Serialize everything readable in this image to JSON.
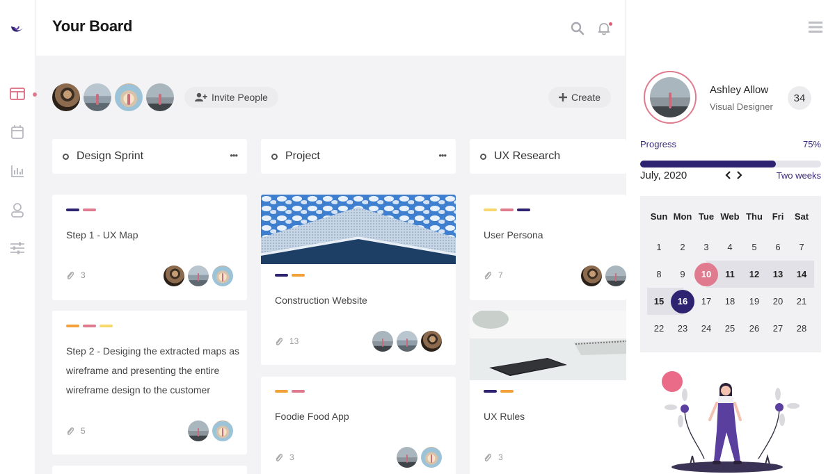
{
  "header": {
    "title": "Your Board"
  },
  "team": {
    "invite_label": "Invite People",
    "create_label": "Create"
  },
  "colors": {
    "pink": "#e07a8f",
    "navy": "#2e2370",
    "orange": "#f3a23a",
    "yellow": "#f6d86b",
    "purple": "#5a3f9e"
  },
  "columns": [
    {
      "title": "Design Sprint",
      "cards": [
        {
          "title": "Step 1 - UX Map",
          "attachments": "3",
          "tags": [
            "navy",
            "pink"
          ]
        },
        {
          "title_lines": [
            "Step 2 - Desiging the extracted maps as",
            "wireframe and presenting the entire",
            "wireframe design to the customer"
          ],
          "attachments": "5",
          "tags": [
            "orange",
            "pink",
            "yellow"
          ]
        }
      ]
    },
    {
      "title": "Project",
      "cards": [
        {
          "title": "Construction Website",
          "attachments": "13",
          "tags": [
            "navy",
            "orange"
          ]
        },
        {
          "title": "Foodie Food App",
          "attachments": "3",
          "tags": [
            "orange",
            "pink"
          ]
        }
      ]
    },
    {
      "title": "UX Research",
      "cards": [
        {
          "title": "User Persona",
          "attachments": "7",
          "tags": [
            "yellow",
            "pink",
            "navy"
          ]
        },
        {
          "title": "UX Rules",
          "attachments": "3",
          "tags": [
            "navy",
            "orange"
          ]
        }
      ]
    }
  ],
  "profile": {
    "name": "Ashley Allow",
    "role": "Visual Designer",
    "count": "34",
    "progress_label": "Progress",
    "progress_value": "75%",
    "progress_fraction": 0.75
  },
  "calendar": {
    "month": "July, 2020",
    "range": "Two weeks",
    "day_names": [
      "Sun",
      "Mon",
      "Tue",
      "Web",
      "Thu",
      "Fri",
      "Sat"
    ],
    "weeks": [
      [
        "1",
        "2",
        "3",
        "4",
        "5",
        "6",
        "7"
      ],
      [
        "8",
        "9",
        "10",
        "11",
        "12",
        "13",
        "14"
      ],
      [
        "15",
        "16",
        "17",
        "18",
        "19",
        "20",
        "21"
      ],
      [
        "22",
        "23",
        "24",
        "25",
        "26",
        "27",
        "28"
      ]
    ],
    "marked_pink": "10",
    "marked_selected": "16"
  }
}
